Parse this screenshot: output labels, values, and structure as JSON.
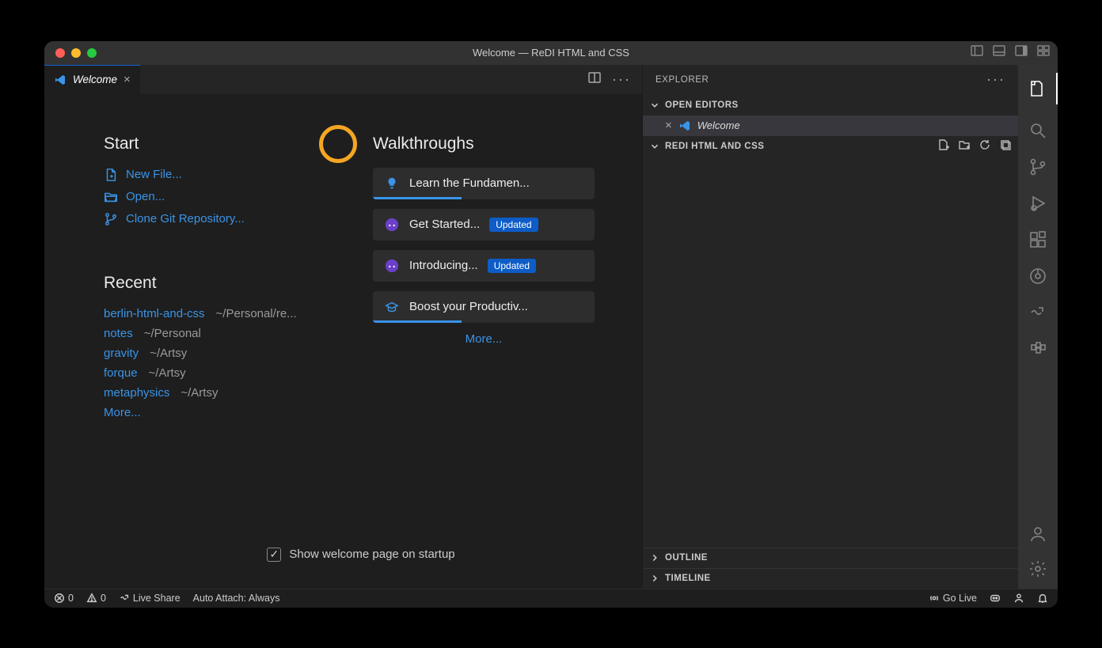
{
  "window": {
    "title": "Welcome — ReDI HTML and CSS"
  },
  "tab": {
    "label": "Welcome"
  },
  "explorer": {
    "title": "EXPLORER",
    "open_editors_label": "OPEN EDITORS",
    "open_editor_item": "Welcome",
    "folder_label": "REDI HTML AND CSS",
    "outline_label": "OUTLINE",
    "timeline_label": "TIMELINE"
  },
  "welcome": {
    "start_heading": "Start",
    "start_links": {
      "new_file": "New File...",
      "open": "Open...",
      "clone": "Clone Git Repository..."
    },
    "recent_heading": "Recent",
    "recent": [
      {
        "name": "berlin-html-and-css",
        "path": "~/Personal/re..."
      },
      {
        "name": "notes",
        "path": "~/Personal"
      },
      {
        "name": "gravity",
        "path": "~/Artsy"
      },
      {
        "name": "forque",
        "path": "~/Artsy"
      },
      {
        "name": "metaphysics",
        "path": "~/Artsy"
      }
    ],
    "more": "More...",
    "walkthroughs_heading": "Walkthroughs",
    "walkthroughs": [
      {
        "label": "Learn the Fundamen...",
        "progress": 40,
        "badge": null,
        "icon": "bulb"
      },
      {
        "label": "Get Started...",
        "progress": 0,
        "badge": "Updated",
        "icon": "gh"
      },
      {
        "label": "Introducing...",
        "progress": 0,
        "badge": "Updated",
        "icon": "gh"
      },
      {
        "label": "Boost your Productiv...",
        "progress": 40,
        "badge": null,
        "icon": "grad"
      }
    ],
    "walk_more": "More...",
    "show_on_startup": "Show welcome page on startup"
  },
  "status": {
    "errors": "0",
    "warnings": "0",
    "live_share": "Live Share",
    "auto_attach": "Auto Attach: Always",
    "go_live": "Go Live"
  }
}
